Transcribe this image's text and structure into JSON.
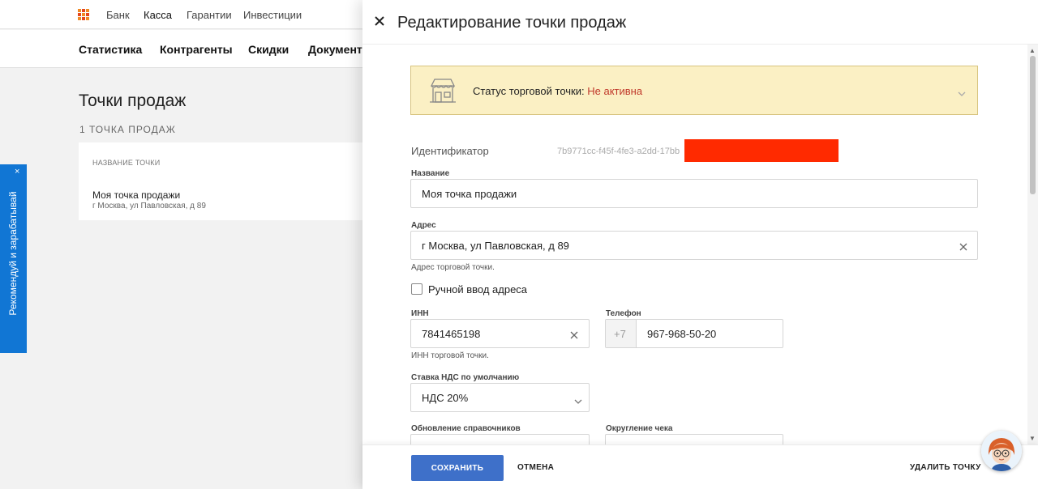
{
  "topnav": {
    "items": [
      "Банк",
      "Касса",
      "Гарантии",
      "Инвестиции"
    ],
    "active": "Касса"
  },
  "subnav": {
    "items": [
      "Статистика",
      "Контрагенты",
      "Скидки",
      "Документы"
    ]
  },
  "page": {
    "title": "Точки продаж",
    "count_label": "1 ТОЧКА ПРОДАЖ",
    "table": {
      "column_header": "НАЗВАНИЕ ТОЧКИ",
      "rows": [
        {
          "name": "Моя точка продажи",
          "address": "г Москва, ул Павловская, д 89"
        }
      ]
    }
  },
  "promo": {
    "text": "Рекомендуй и зарабатывай",
    "close": "×"
  },
  "panel": {
    "title": "Редактирование точки продаж",
    "status": {
      "label": "Статус торговой точки:",
      "value": "Не активна",
      "value_color": "#c0392b"
    },
    "identifier": {
      "label": "Идентификатор",
      "value": "7b9771cc-f45f-4fe3-a2dd-17bb"
    },
    "name_field": {
      "label": "Название",
      "value": "Моя точка продажи"
    },
    "address_field": {
      "label": "Адрес",
      "value": "г Москва, ул Павловская, д 89",
      "hint": "Адрес торговой точки."
    },
    "manual_address": {
      "label": "Ручной ввод адреса",
      "checked": false
    },
    "inn_field": {
      "label": "ИНН",
      "value": "7841465198",
      "hint": "ИНН торговой точки."
    },
    "phone_field": {
      "label": "Телефон",
      "prefix": "+7",
      "value": "967-968-50-20"
    },
    "vat_field": {
      "label": "Ставка НДС по умолчанию",
      "value": "НДС 20%"
    },
    "refs_field": {
      "label": "Обновление справочников"
    },
    "rounding_field": {
      "label": "Округление чека"
    },
    "footer": {
      "save": "СОХРАНИТЬ",
      "cancel": "ОТМЕНА",
      "delete": "УДАЛИТЬ ТОЧКУ"
    }
  },
  "colors": {
    "accent": "#3e70c9",
    "status_bg": "#fbf0c4",
    "promo": "#1176d4",
    "redaction": "#ff2a00"
  }
}
